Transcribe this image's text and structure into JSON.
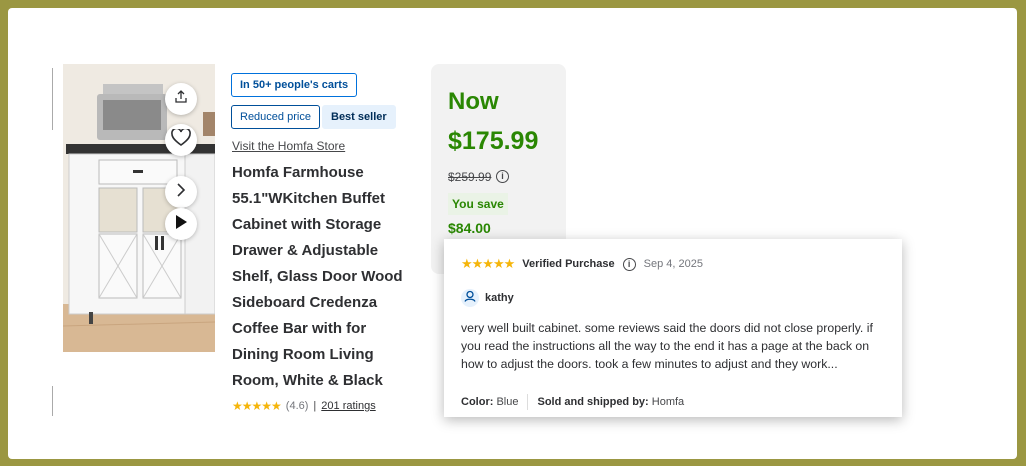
{
  "badges": {
    "carts": "In 50+ people's carts",
    "reduced": "Reduced price",
    "best_seller": "Best seller"
  },
  "store_link": "Visit the Homfa Store",
  "product": {
    "title": "Homfa Farmhouse 55.1\"WKitchen Buffet Cabinet with Storage Drawer & Adjustable Shelf, Glass Door Wood Sideboard Credenza Coffee Bar with for Dining Room Living Room, White & Black",
    "stars_display": "★★★★★",
    "rating_value": 4.6,
    "rating_text": "(4.6)",
    "rating_separator": "|",
    "ratings_link": "201 ratings"
  },
  "pricing": {
    "now_label": "Now",
    "price": "$175.99",
    "was_price": "$259.99",
    "info_glyph": "i",
    "save_label": "You save",
    "save_amount": "$84.00",
    "color_green": "#2a8703"
  },
  "review": {
    "stars_display": "★★★★★",
    "verified": "Verified Purchase",
    "info_glyph": "i",
    "date": "Sep 4, 2025",
    "user": "kathy",
    "text": "very well built cabinet. some reviews said the doors did not close properly. if you read the instructions all the way to the end it has a page at the back on how to adjust the doors. took a few minutes to adjust and they work...",
    "color_label": "Color:",
    "color_value": "Blue",
    "shipped_label": "Sold and shipped by:",
    "shipped_value": "Homfa"
  },
  "icons": {
    "share": "share-icon",
    "heart": "heart-icon",
    "next": "chevron-right-icon",
    "play": "play-icon",
    "user": "user-icon",
    "info": "info-icon"
  },
  "colors": {
    "frame": "#9b9742",
    "star": "#f5b50a",
    "link_blue": "#004f9a"
  }
}
